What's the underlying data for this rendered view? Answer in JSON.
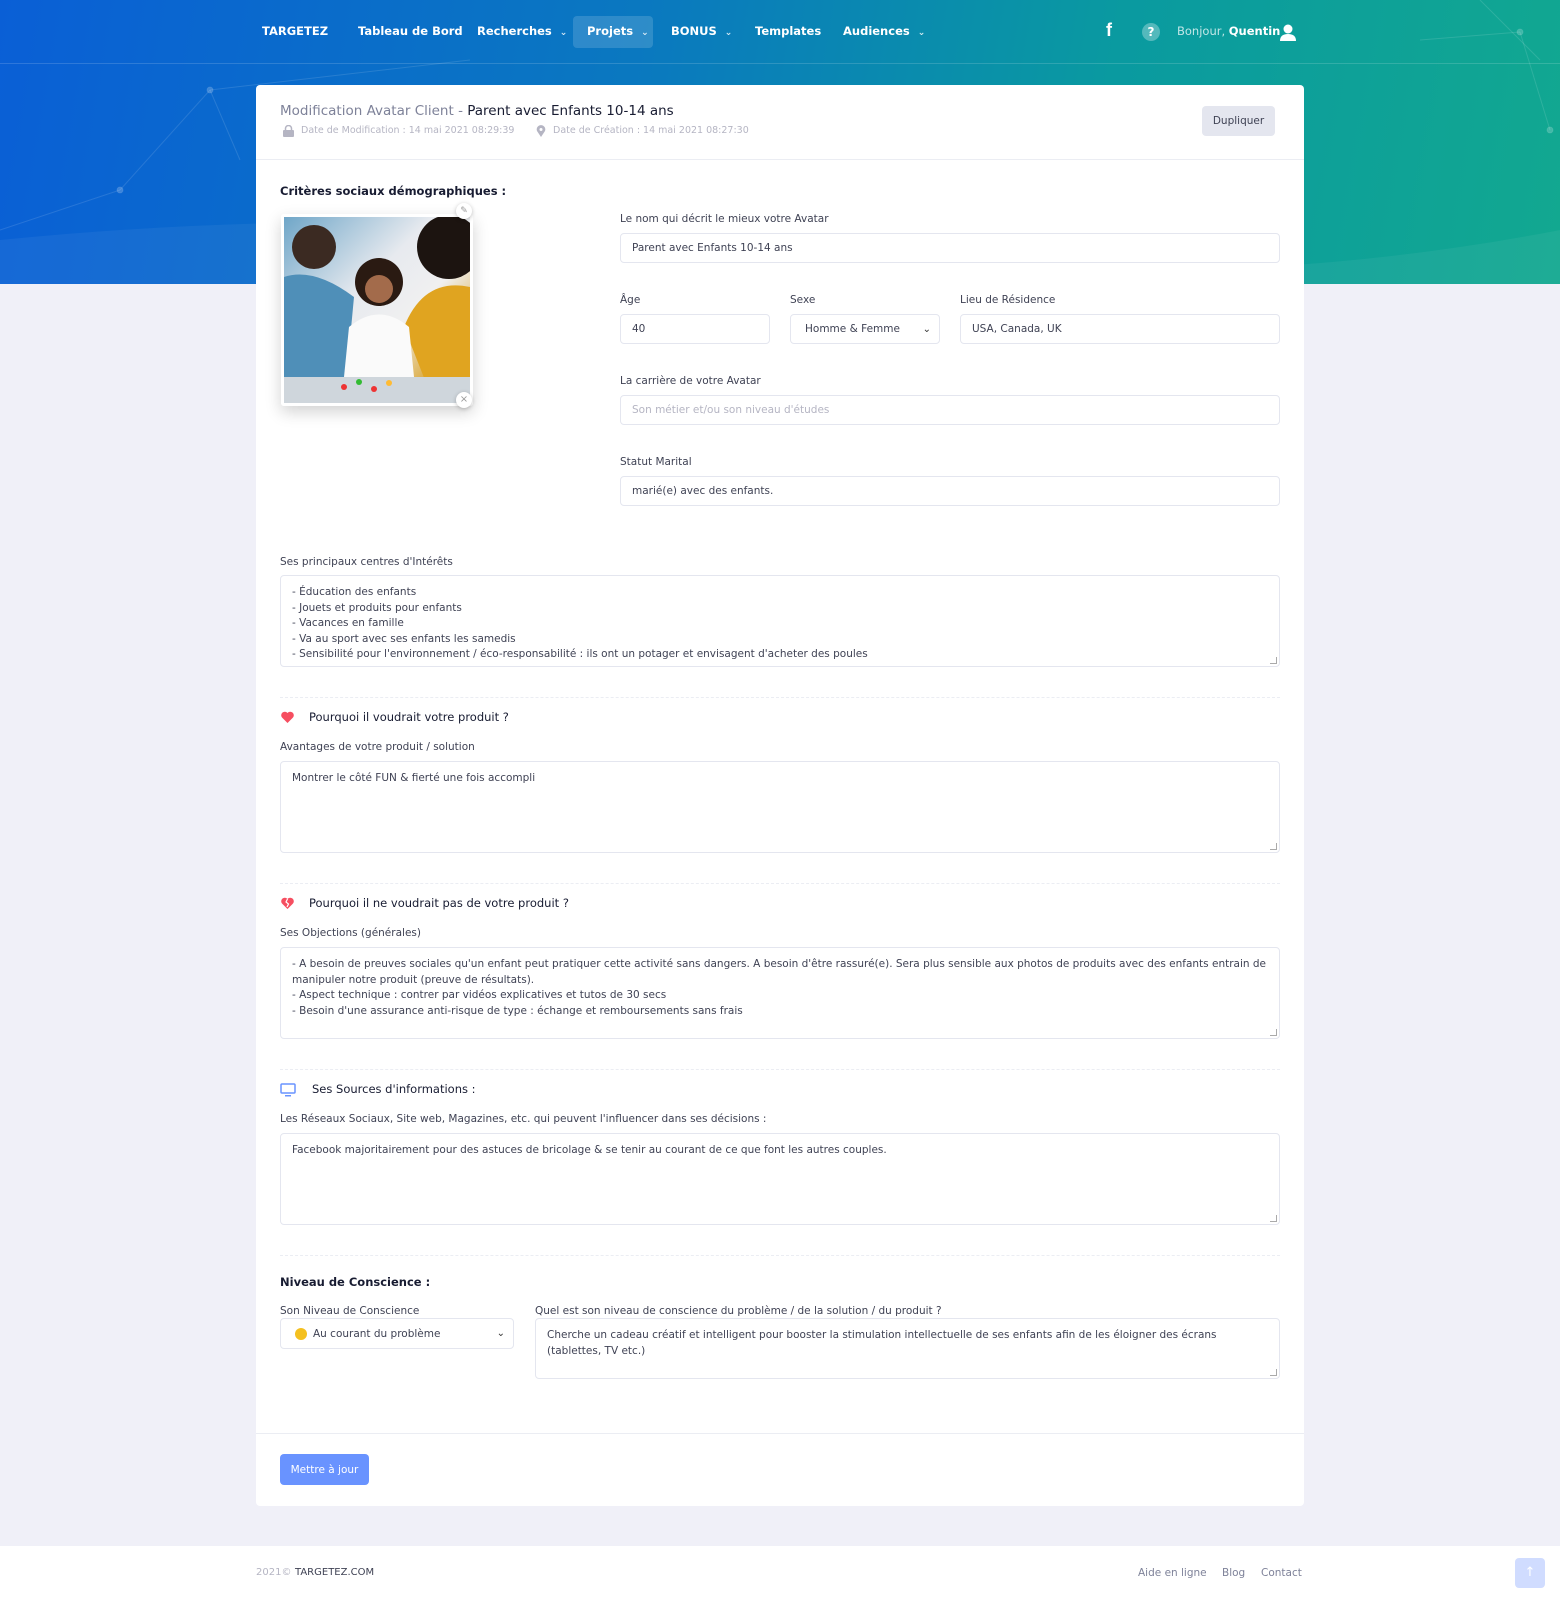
{
  "nav": {
    "brand": "TARGETEZ",
    "items": [
      {
        "label": "Tableau de Bord"
      },
      {
        "label": "Recherches"
      },
      {
        "label": "Projets"
      },
      {
        "label": "BONUS"
      },
      {
        "label": "Templates"
      },
      {
        "label": "Audiences"
      }
    ],
    "greeting": "Bonjour,",
    "user": "Quentin",
    "icons": [
      "facebook-icon",
      "help-icon",
      "user-icon"
    ]
  },
  "header": {
    "title_prefix": "Modification Avatar Client -",
    "title_name": "Parent avec Enfants 10-14 ans",
    "modified": "Date de Modification : 14 mai 2021 08:29:39",
    "created": "Date de Création : 14 mai 2021 08:27:30",
    "duplicate_label": "Dupliquer"
  },
  "socio": {
    "title": "Critères sociaux démographiques :",
    "name_label": "Le nom qui décrit le mieux votre Avatar",
    "name_value": "Parent avec Enfants 10-14 ans",
    "age_label": "Âge",
    "age_value": "40",
    "sex_label": "Sexe",
    "sex_value": "Homme & Femme",
    "residence_label": "Lieu de Résidence",
    "residence_value": "USA, Canada, UK",
    "career_label": "La carrière de votre Avatar",
    "career_placeholder": "Son métier et/ou son niveau d'études",
    "marital_label": "Statut Marital",
    "marital_value": "marié(e) avec des enfants.",
    "interests_label": "Ses principaux centres d'Intérêts",
    "interests_value": "- Éducation des enfants\n- Jouets et produits pour enfants\n- Vacances en famille\n- Va au sport avec ses enfants les samedis\n- Sensibilité pour l'environnement / éco-responsabilité : ils ont un potager et envisagent d'acheter des poules"
  },
  "why": {
    "title": "Pourquoi il voudrait votre produit ?",
    "label": "Avantages de votre produit / solution",
    "value": "Montrer le côté FUN & fierté une fois accompli"
  },
  "whynot": {
    "title": "Pourquoi il ne voudrait pas de votre produit ?",
    "label": "Ses Objections (générales)",
    "value": "- A besoin de preuves sociales qu'un enfant peut pratiquer cette activité sans dangers. A besoin d'être rassuré(e). Sera plus sensible aux photos de produits avec des enfants entrain de manipuler notre produit (preuve de résultats).\n- Aspect technique : contrer par vidéos explicatives et tutos de 30 secs\n- Besoin d'une assurance anti-risque de type : échange et remboursements sans frais"
  },
  "sources": {
    "title": "Ses Sources d'informations :",
    "label": "Les Réseaux Sociaux, Site web, Magazines, etc. qui peuvent l'influencer dans ses décisions :",
    "value": "Facebook majoritairement pour des astuces de bricolage & se tenir au courant de ce que font les autres couples."
  },
  "awareness": {
    "title": "Niveau de Conscience :",
    "level_label": "Son Niveau de Conscience",
    "level_value": "Au courant du problème",
    "question_label": "Quel est son niveau de conscience du problème / de la solution / du produit ?",
    "question_value": "Cherche un cadeau créatif et intelligent pour booster la stimulation intellectuelle de ses enfants afin de les éloigner des écrans (tablettes, TV etc.)"
  },
  "submit_label": "Mettre à jour",
  "footer": {
    "year": "2021©",
    "site": "TARGETEZ.COM",
    "links": [
      {
        "label": "Aide en ligne"
      },
      {
        "label": "Blog"
      },
      {
        "label": "Contact"
      }
    ]
  },
  "colors": {
    "primary": "#6993ff",
    "heart": "#f64e60",
    "page_bg": "#f0f0f8"
  }
}
